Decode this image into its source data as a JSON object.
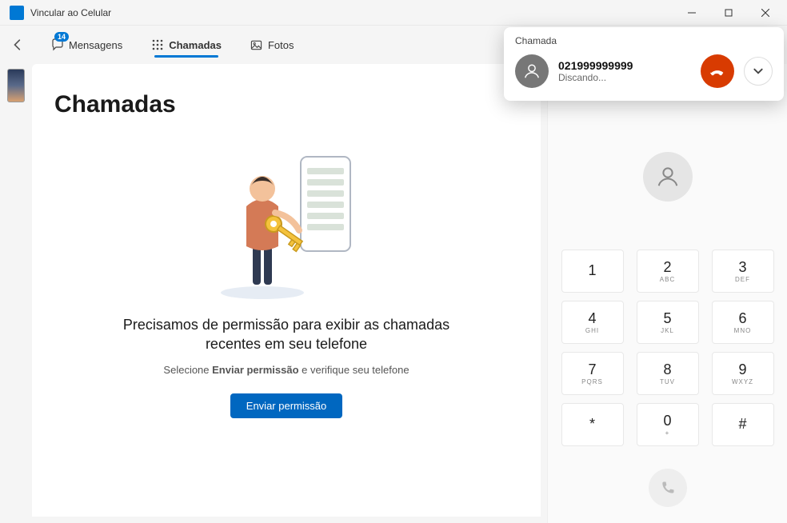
{
  "titlebar": {
    "title": "Vincular ao Celular"
  },
  "tabs": {
    "messages": {
      "label": "Mensagens",
      "badge": "14"
    },
    "calls": {
      "label": "Chamadas"
    },
    "photos": {
      "label": "Fotos"
    }
  },
  "page": {
    "title": "Chamadas",
    "empty_title": "Precisamos de permissão para exibir as chamadas recentes em seu telefone",
    "empty_sub_pre": "Selecione ",
    "empty_sub_bold": "Enviar permissão",
    "empty_sub_post": " e verifique seu telefone",
    "primary_button": "Enviar permissão"
  },
  "keypad": [
    {
      "num": "1",
      "letters": ""
    },
    {
      "num": "2",
      "letters": "ABC"
    },
    {
      "num": "3",
      "letters": "DEF"
    },
    {
      "num": "4",
      "letters": "GHI"
    },
    {
      "num": "5",
      "letters": "JKL"
    },
    {
      "num": "6",
      "letters": "MNO"
    },
    {
      "num": "7",
      "letters": "PQRS"
    },
    {
      "num": "8",
      "letters": "TUV"
    },
    {
      "num": "9",
      "letters": "WXYZ"
    },
    {
      "num": "*",
      "letters": ""
    },
    {
      "num": "0",
      "letters": "+"
    },
    {
      "num": "#",
      "letters": ""
    }
  ],
  "call_popup": {
    "title": "Chamada",
    "number": "021999999999",
    "status": "Discando..."
  }
}
